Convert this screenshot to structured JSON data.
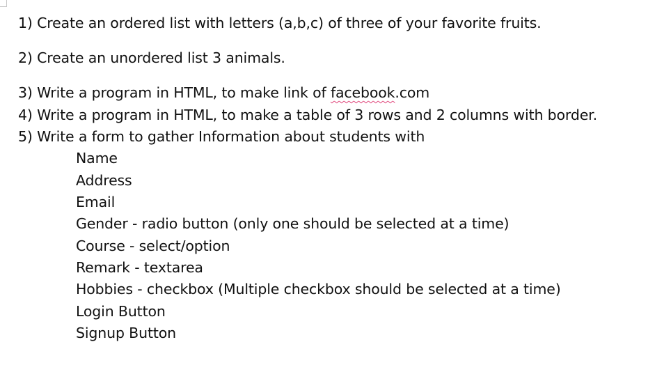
{
  "items": [
    "1) Create an ordered list with letters (a,b,c) of three of your favorite fruits.",
    "2) Create an unordered list 3 animals.",
    "3) Write a program in HTML, to make link of ",
    "4) Write a program in HTML, to make a table of 3 rows and 2 columns with border.",
    "5) Write a form to gather Information about students with"
  ],
  "link_word": "facebook",
  "link_suffix": ".com",
  "form_fields": [
    "Name",
    "Address",
    "Email",
    "Gender - radio button (only one should be selected at a time)",
    "Course - select/option",
    "Remark - textarea",
    "Hobbies - checkbox (Multiple checkbox should be selected at a time)",
    "Login Button",
    "Signup Button"
  ]
}
